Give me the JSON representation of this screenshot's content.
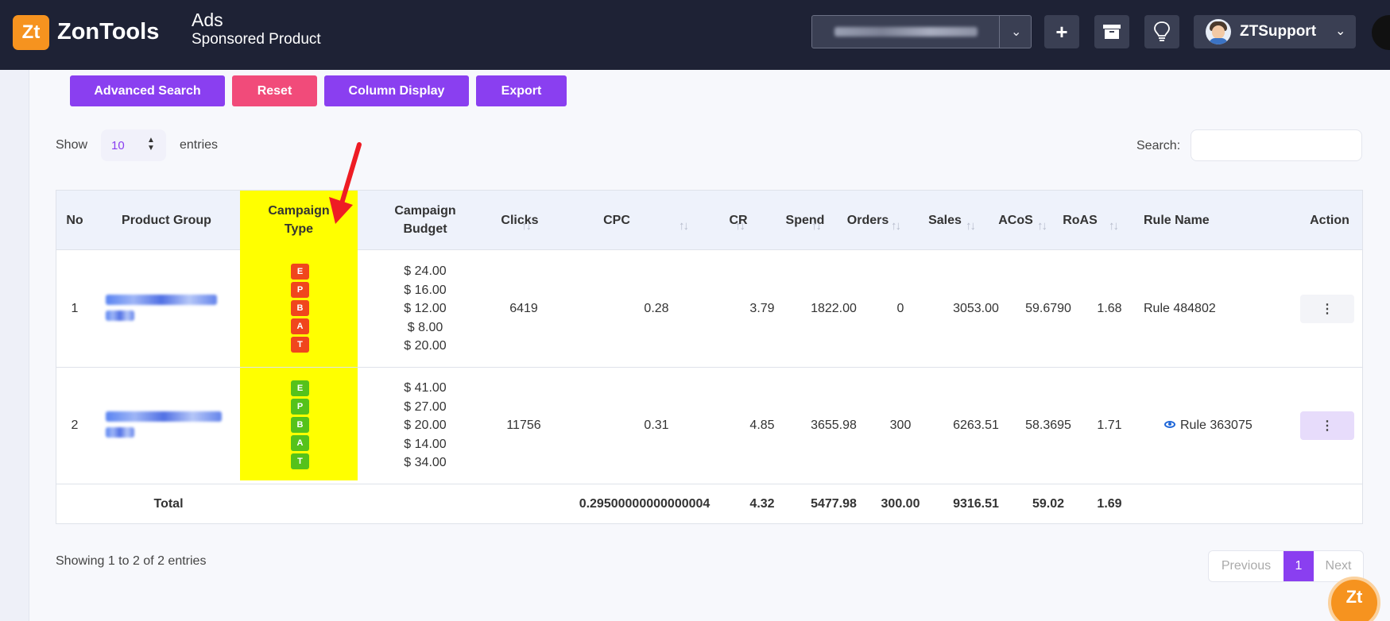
{
  "header": {
    "logo_text": "ZonTools",
    "logo_badge": "Zt",
    "title": "Ads",
    "subtitle": "Sponsored Product",
    "user_name": "ZTSupport",
    "add_icon": "plus-icon",
    "archive_icon": "archive-icon",
    "idea_icon": "lightbulb-icon"
  },
  "toolbar": {
    "advanced_search": "Advanced Search",
    "reset": "Reset",
    "column_display": "Column Display",
    "export": "Export"
  },
  "entries": {
    "show_label": "Show",
    "value": "10",
    "suffix_label": "entries",
    "search_label": "Search:",
    "search_value": ""
  },
  "table": {
    "columns": {
      "no": "No",
      "product_group": "Product Group",
      "campaign_type_1": "Campaign",
      "campaign_type_2": "Type",
      "campaign_budget_1": "Campaign",
      "campaign_budget_2": "Budget",
      "clicks": "Clicks",
      "cpc": "CPC",
      "cr": "CR",
      "spend": "Spend",
      "orders": "Orders",
      "sales": "Sales",
      "acos": "ACoS",
      "roas": "RoAS",
      "rule_name": "Rule Name",
      "action": "Action"
    },
    "sort_glyph": "↑↓",
    "rows": [
      {
        "no": "1",
        "campaign_types": [
          "E",
          "P",
          "B",
          "A",
          "T"
        ],
        "budgets": [
          "$ 24.00",
          "$ 16.00",
          "$ 12.00",
          "$ 8.00",
          "$ 20.00"
        ],
        "clicks": "6419",
        "cpc": "0.28",
        "cr": "3.79",
        "spend": "1822.00",
        "orders": "0",
        "sales": "3053.00",
        "acos": "59.6790",
        "roas": "1.68",
        "rule_name": "Rule 484802",
        "action": "⋮",
        "badge_color": "#f0461d"
      },
      {
        "no": "2",
        "campaign_types": [
          "E",
          "P",
          "B",
          "A",
          "T"
        ],
        "budgets": [
          "$ 41.00",
          "$ 27.00",
          "$ 20.00",
          "$ 14.00",
          "$ 34.00"
        ],
        "clicks": "11756",
        "cpc": "0.31",
        "cr": "4.85",
        "spend": "3655.98",
        "orders": "300",
        "sales": "6263.51",
        "acos": "58.3695",
        "roas": "1.71",
        "rule_name": "Rule 363075",
        "action": "⋮",
        "badge_color": "#55c21b"
      }
    ],
    "totals": {
      "label": "Total",
      "cpc": "0.29500000000000004",
      "cr": "4.32",
      "spend": "5477.98",
      "orders": "300.00",
      "sales": "9316.51",
      "acos": "59.02",
      "roas": "1.69"
    }
  },
  "footer": {
    "showing": "Showing 1 to 2 of 2 entries",
    "previous": "Previous",
    "page": "1",
    "next": "Next"
  },
  "help": {
    "badge": "Zt"
  },
  "colors": {
    "accent": "#8a3ff0",
    "reset": "#f14b7a",
    "highlight": "#ffff00",
    "topbar": "#1e2235"
  }
}
